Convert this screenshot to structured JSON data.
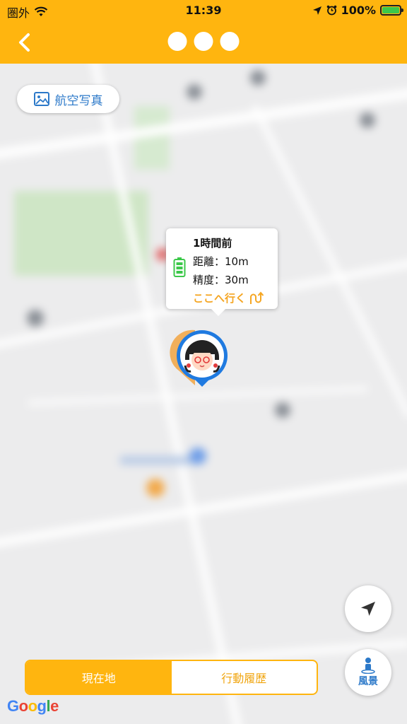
{
  "status_bar": {
    "carrier": "圏外",
    "time": "11:39",
    "battery": "100%"
  },
  "nav": {
    "back_icon": "chevron-left-icon"
  },
  "map": {
    "aerial_button_label": "航空写真",
    "popup": {
      "time_ago": "1時間前",
      "distance": "距離：10m",
      "accuracy": "精度：30m",
      "go_here": "ここへ行く"
    },
    "scene_button_label": "風景",
    "attribution": "Google"
  },
  "tabs": {
    "current": "現在地",
    "history": "行動履歴",
    "active": "current"
  },
  "colors": {
    "accent": "#ffb50f",
    "link_blue": "#2c79c9",
    "go_orange": "#f5a623",
    "battery_green": "#3cc84a"
  }
}
